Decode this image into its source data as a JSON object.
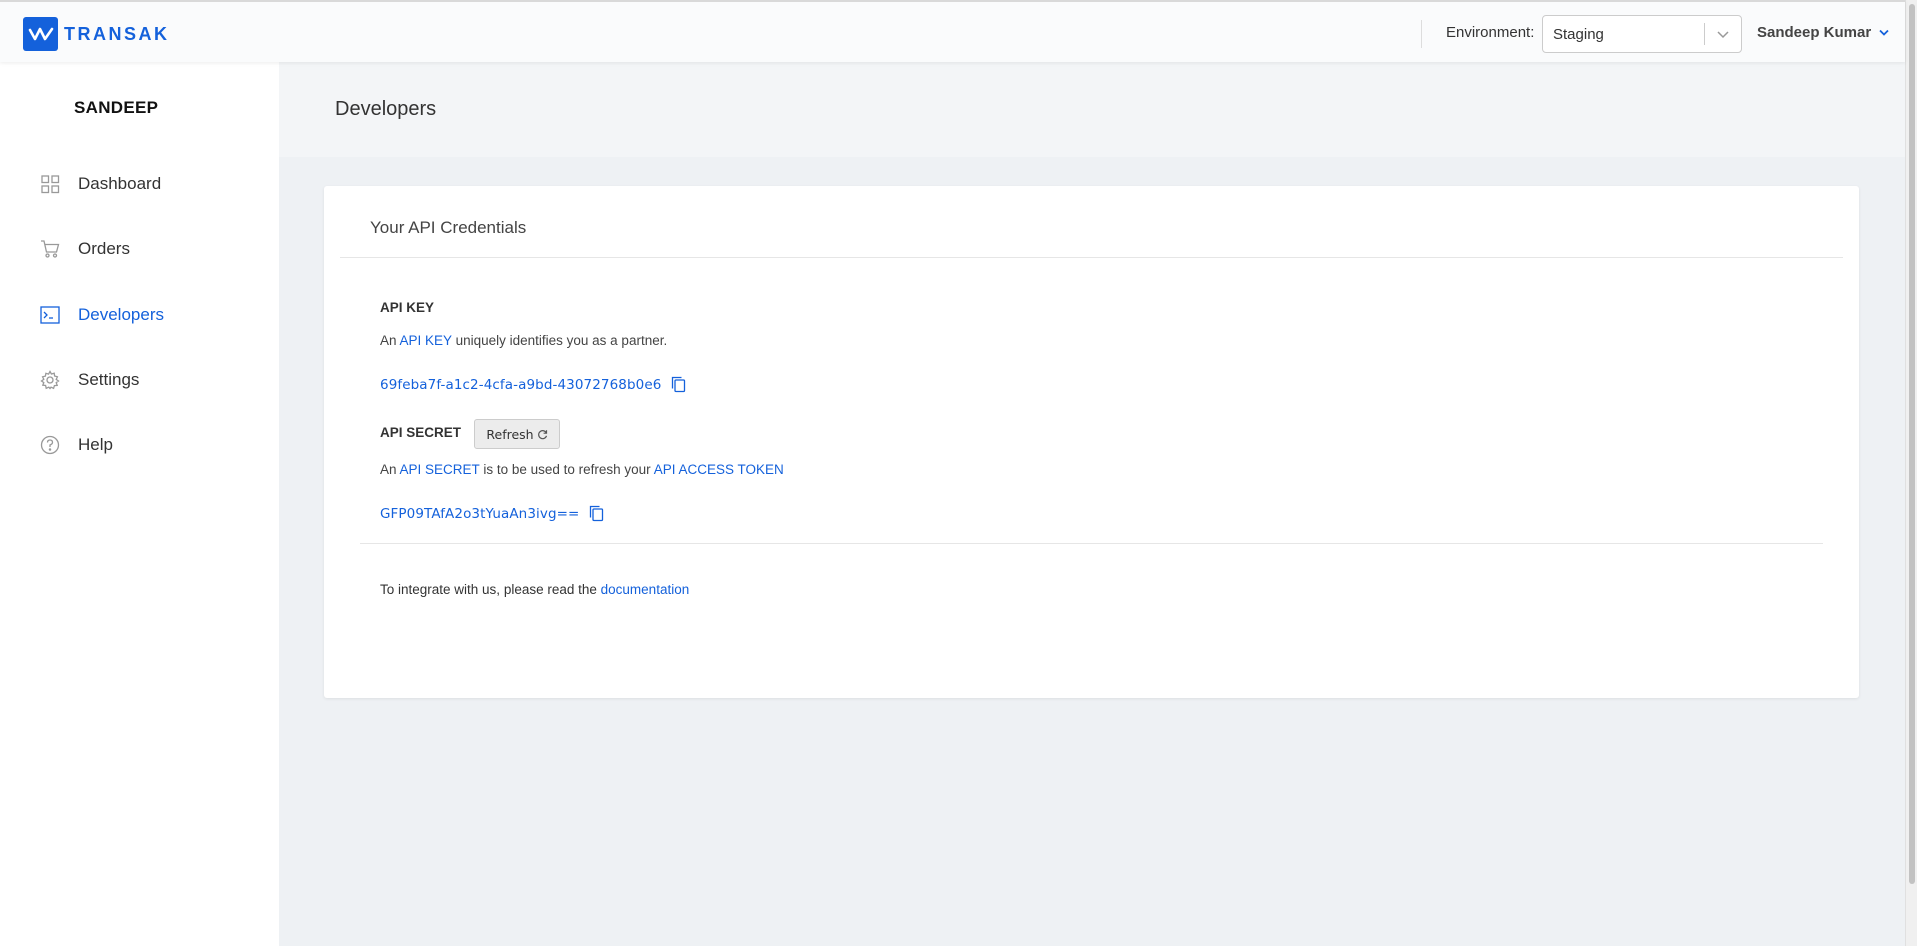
{
  "brand": {
    "name": "TRANSAK",
    "color": "#1461db"
  },
  "header": {
    "environment_label": "Environment:",
    "environment_value": "Staging",
    "user_name": "Sandeep Kumar"
  },
  "sidebar": {
    "org_name": "SANDEEP",
    "items": [
      {
        "label": "Dashboard",
        "icon": "grid-icon"
      },
      {
        "label": "Orders",
        "icon": "cart-icon"
      },
      {
        "label": "Developers",
        "icon": "terminal-icon",
        "active": true
      },
      {
        "label": "Settings",
        "icon": "gear-icon"
      },
      {
        "label": "Help",
        "icon": "help-circle-icon"
      }
    ]
  },
  "page": {
    "title": "Developers"
  },
  "credentials": {
    "card_title": "Your API Credentials",
    "api_key": {
      "label": "API KEY",
      "desc_prefix": "An",
      "desc_link": "API KEY",
      "desc_suffix": "uniquely identifies you as a partner.",
      "value": "69feba7f-a1c2-4cfa-a9bd-43072768b0e6"
    },
    "api_secret": {
      "label": "API SECRET",
      "refresh_label": "Refresh",
      "desc_prefix": "An",
      "desc_link_1": "API SECRET",
      "desc_middle": "is to be used to refresh your",
      "desc_link_2": "API ACCESS TOKEN",
      "value": "GFP09TAfA2o3tYuaAn3ivg=="
    },
    "docs": {
      "text": "To integrate with us, please read the",
      "link": "documentation"
    }
  }
}
